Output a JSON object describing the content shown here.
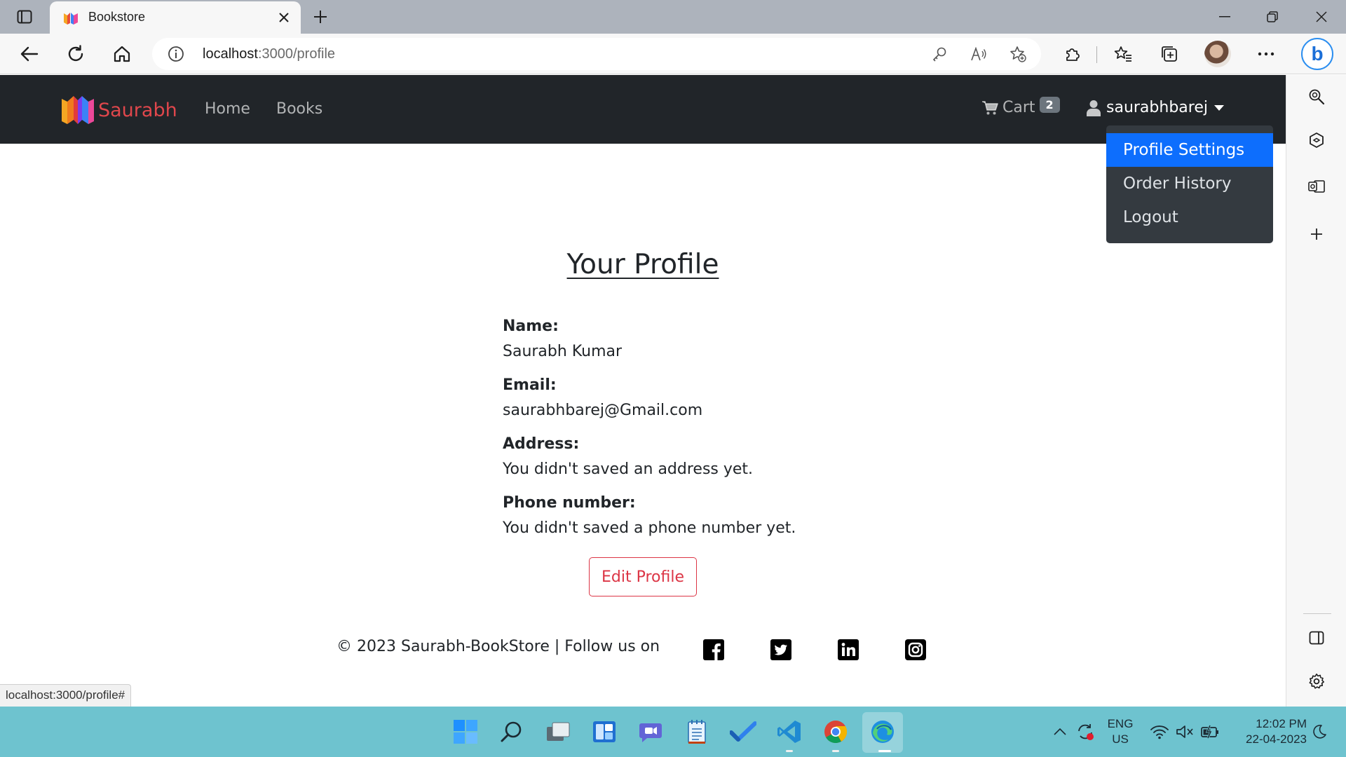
{
  "browser": {
    "tab": {
      "title": "Bookstore"
    },
    "address": {
      "host": "localhost",
      "path": ":3000/profile"
    }
  },
  "navbar": {
    "brand": "Saurabh",
    "links": [
      "Home",
      "Books"
    ],
    "cart": {
      "label": "Cart",
      "count": "2"
    },
    "user": {
      "name": "saurabhbarej"
    },
    "dropdown": [
      "Profile Settings",
      "Order History",
      "Logout"
    ]
  },
  "profile": {
    "title": "Your Profile",
    "fields": [
      {
        "label": "Name:",
        "value": "Saurabh Kumar"
      },
      {
        "label": "Email:",
        "value": "saurabhbarej@Gmail.com"
      },
      {
        "label": "Address:",
        "value": "You didn't saved an address yet."
      },
      {
        "label": "Phone number:",
        "value": "You didn't saved a phone number yet."
      }
    ],
    "edit_button": "Edit Profile"
  },
  "footer": {
    "text": "© 2023 Saurabh-BookStore | Follow us on",
    "social_icons": [
      "facebook-icon",
      "twitter-icon",
      "linkedin-icon",
      "instagram-icon"
    ]
  },
  "status_bar": {
    "url": "localhost:3000/profile#"
  },
  "taskbar": {
    "language": {
      "line1": "ENG",
      "line2": "US"
    },
    "clock": {
      "time": "12:02 PM",
      "date": "22-04-2023"
    }
  },
  "colors": {
    "navbar_bg": "#212529",
    "brand": "#e0474c",
    "dropdown_active": "#0d6efd",
    "edit_button": "#dc3545",
    "taskbar": "#6ec3cf"
  }
}
